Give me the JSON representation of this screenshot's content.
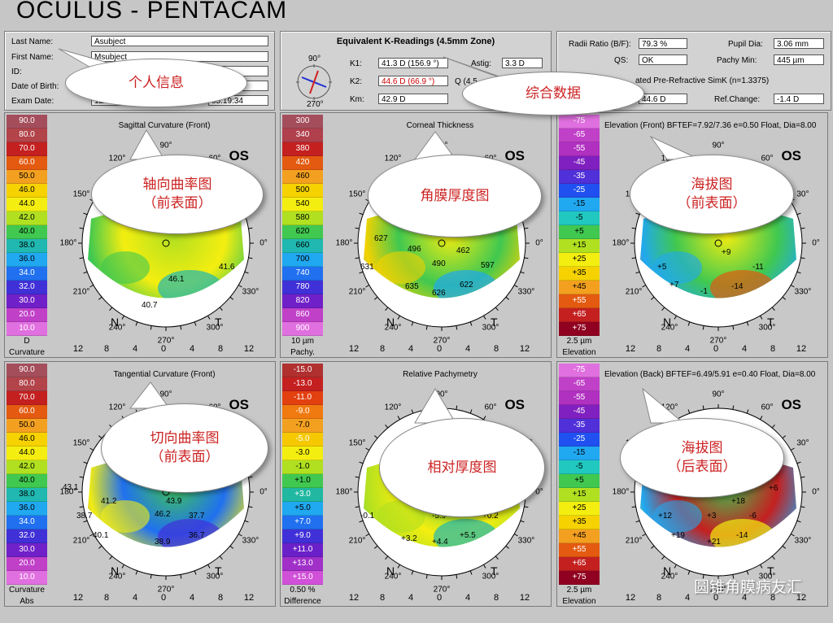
{
  "app": {
    "title": "OCULUS  -  PENTACAM"
  },
  "patient": {
    "last_name_label": "Last Name:",
    "last_name": "Asubject",
    "first_name_label": "First Name:",
    "first_name": "Msubject",
    "id_label": "ID:",
    "id": "",
    "dob_label": "Date of Birth:",
    "dob": "",
    "exam_label": "Exam Date:",
    "exam_date": "12/",
    "exam_time": "05:19:34"
  },
  "kreadings": {
    "title": "Equivalent K-Readings (4.5mm Zone)",
    "k1_label": "K1:",
    "k1": "41.3 D",
    "k1_axis": "(156.9 °)",
    "k2_label": "K2:",
    "k2": "44.6 D",
    "k2_axis": "(66.9 °)",
    "km_label": "Km:",
    "km": "42.9 D",
    "astig_label": "Astig:",
    "astig": "3.3 D",
    "q_label": "Q (4.5",
    "q": "",
    "dial_top": "90°",
    "dial_bottom": "270°",
    "dial_left": "180°",
    "dial_right": "0°"
  },
  "other": {
    "radii_label": "Radii Ratio (B/F):",
    "radii": "79.3 %",
    "qs_label": "QS:",
    "qs": "OK",
    "pupil_label": "Pupil Dia:",
    "pupil": "3.06 mm",
    "pachy_label": "Pachy Min:",
    "pachy": "445 µm",
    "simk_label": "ated Pre-Refractive SimK (n=1.3375)",
    "simk": "44.6 D",
    "refchange_label": "Ref.Change:",
    "refchange": "-1.4 D"
  },
  "maps": [
    {
      "title": "Sagittal Curvature (Front)",
      "eye": "OS",
      "scale_values": [
        "90.0",
        "80.0",
        "70.0",
        "60.0",
        "50.0",
        "46.0",
        "44.0",
        "42.0",
        "40.0",
        "38.0",
        "36.0",
        "34.0",
        "32.0",
        "30.0",
        "20.0",
        "10.0"
      ],
      "scale_colors": [
        "#a44e5c",
        "#b2444a",
        "#c42020",
        "#e35a10",
        "#f3a020",
        "#f5d200",
        "#f4ee10",
        "#b0e020",
        "#40c850",
        "#20b8b0",
        "#20a8f0",
        "#2070f0",
        "#4030d8",
        "#7020c8",
        "#c040c8",
        "#e070e0"
      ],
      "scale_unit": "D",
      "scale_name": "Curvature",
      "scale_mode": "Abs",
      "values": [
        "46.1",
        "41.6",
        "40.7"
      ],
      "title_tail": "",
      "quadrant": "N",
      "quadrant2": "T"
    },
    {
      "title": "Corneal Thickness",
      "eye": "OS",
      "scale_values": [
        "300",
        "340",
        "380",
        "420",
        "460",
        "500",
        "540",
        "580",
        "620",
        "660",
        "700",
        "740",
        "780",
        "820",
        "860",
        "900"
      ],
      "scale_colors": [
        "#a44e5c",
        "#b0404c",
        "#c42020",
        "#e35a10",
        "#f3a020",
        "#f5d200",
        "#f4ee10",
        "#b0e020",
        "#40c850",
        "#20b8b0",
        "#20a8f0",
        "#2070f0",
        "#4030d8",
        "#7020c8",
        "#c040c8",
        "#e070e0"
      ],
      "scale_unit": "10 µm",
      "scale_name": "Pachy.",
      "scale_mode": "Abs",
      "values": [
        "496",
        "462",
        "490",
        "631",
        "597",
        "635",
        "626",
        "622",
        "627"
      ],
      "quadrant": "N",
      "quadrant2": "T"
    },
    {
      "title": "Elevation (Front)  BFTEF=7.92/7.36 e=0.50 Float, Dia=8.00",
      "eye": "OS",
      "scale_values": [
        "-75",
        "-65",
        "-55",
        "-45",
        "-35",
        "-25",
        "-15",
        "-5",
        "+5",
        "+15",
        "+25",
        "+35",
        "+45",
        "+55",
        "+65",
        "+75"
      ],
      "scale_colors": [
        "#e070e0",
        "#c040c8",
        "#b030c0",
        "#8020c0",
        "#5030d8",
        "#2050f0",
        "#20a8f0",
        "#20c8c0",
        "#40c850",
        "#b0e020",
        "#f4ee10",
        "#f5d200",
        "#f3a020",
        "#e35a10",
        "#c42020",
        "#900020"
      ],
      "scale_unit": "2.5 µm",
      "scale_name": "Elevation",
      "scale_mode": "Height",
      "values": [
        "+9",
        "-11",
        "+5",
        "+7",
        "-1",
        "-14"
      ],
      "quadrant": "N",
      "quadrant2": "T"
    },
    {
      "title": "Tangential Curvature (Front)",
      "eye": "OS",
      "scale_values": [
        "90.0",
        "80.0",
        "70.0",
        "60.0",
        "50.0",
        "46.0",
        "44.0",
        "42.0",
        "40.0",
        "38.0",
        "36.0",
        "34.0",
        "32.0",
        "30.0",
        "20.0",
        "10.0"
      ],
      "scale_colors": [
        "#a44e5c",
        "#b2444a",
        "#c42020",
        "#e35a10",
        "#f3a020",
        "#f5d200",
        "#f4ee10",
        "#b0e020",
        "#40c850",
        "#20b8b0",
        "#20a8f0",
        "#2070f0",
        "#4030d8",
        "#7020c8",
        "#c040c8",
        "#e070e0"
      ],
      "scale_unit": "Curvature",
      "scale_name": "Abs",
      "scale_mode": "",
      "values": [
        "43.1",
        "41.2",
        "43.9",
        "38.7",
        "46.2",
        "37.7",
        "40.1",
        "38.9",
        "36.7"
      ],
      "quadrant": "N",
      "quadrant2": "T"
    },
    {
      "title": "Relative Pachymetry",
      "eye": "OS",
      "scale_values": [
        "-15.0",
        "-13.0",
        "-11.0",
        "-9.0",
        "-7.0",
        "-5.0",
        "-3.0",
        "-1.0",
        "+1.0",
        "+3.0",
        "+5.0",
        "+7.0",
        "+9.0",
        "+11.0",
        "+13.0",
        "+15.0"
      ],
      "scale_colors": [
        "#b03030",
        "#c42020",
        "#e34010",
        "#f07a10",
        "#f3a020",
        "#f5c800",
        "#f4ee10",
        "#b0e020",
        "#40c850",
        "#20b8a0",
        "#20a8f0",
        "#2070f0",
        "#4030d8",
        "#6a20c8",
        "#a030c8",
        "#d050d8"
      ],
      "scale_unit": "0.50 %",
      "scale_name": "Difference",
      "scale_mode": "Rel",
      "values": [
        "-0.1",
        "-5.9",
        "+0.2",
        "+3.2",
        "+4.4",
        "+5.5"
      ],
      "quadrant": "N",
      "quadrant2": "T"
    },
    {
      "title": "Elevation (Back)  BFTEF=6.49/5.91 e=0.40 Float, Dia=8.00",
      "eye": "OS",
      "scale_values": [
        "-75",
        "-65",
        "-55",
        "-45",
        "-35",
        "-25",
        "-15",
        "-5",
        "+5",
        "+15",
        "+25",
        "+35",
        "+45",
        "+55",
        "+65",
        "+75"
      ],
      "scale_colors": [
        "#e070e0",
        "#c040c8",
        "#b030c0",
        "#8020c0",
        "#5030d8",
        "#2050f0",
        "#20a8f0",
        "#20c8c0",
        "#40c850",
        "#b0e020",
        "#f4ee10",
        "#f5d200",
        "#f3a020",
        "#e35a10",
        "#c42020",
        "#900020"
      ],
      "scale_unit": "2.5 µm",
      "scale_name": "Elevation",
      "scale_mode": "Height",
      "values": [
        "+18",
        "+6",
        "+12",
        "+3",
        "-6",
        "+19",
        "+21",
        "-14"
      ],
      "quadrant": "N",
      "quadrant2": "T"
    }
  ],
  "xaxis": [
    "12",
    "8",
    "4",
    "0",
    "4",
    "8",
    "12"
  ],
  "callouts": {
    "personal": "个人信息",
    "summary": "综合数据",
    "axial_1": "轴向曲率图",
    "axial_2": "（前表面）",
    "thick": "角膜厚度图",
    "elevf_1": "海拔图",
    "elevf_2": "（前表面）",
    "tang_1": "切向曲率图",
    "tang_2": "（前表面）",
    "relpachy": "相对厚度图",
    "elevb_1": "海拔图",
    "elevb_2": "（后表面）"
  },
  "watermark": "圆锥角膜病友汇",
  "colors": {
    "background": "#c6c6c6",
    "callout_text": "#cc2222"
  }
}
